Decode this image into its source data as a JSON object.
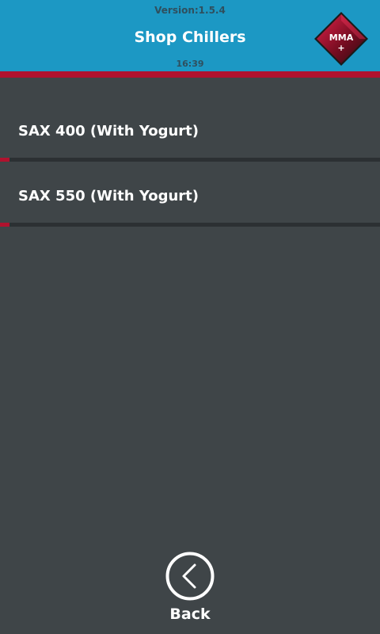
{
  "header": {
    "version": "Version:1.5.4",
    "title": "Shop Chillers",
    "time": "16:39",
    "logo_text": "MMA",
    "logo_plus": "+"
  },
  "list": {
    "items": [
      {
        "label": "SAX 400 (With Yogurt)"
      },
      {
        "label": "SAX 550 (With Yogurt)"
      }
    ]
  },
  "footer": {
    "back_label": "Back",
    "back_icon": "chevron-left-circle-icon"
  },
  "colors": {
    "header_bg": "#1c98c4",
    "accent": "#b0122e",
    "background": "#3f4548",
    "text": "#ffffff"
  }
}
